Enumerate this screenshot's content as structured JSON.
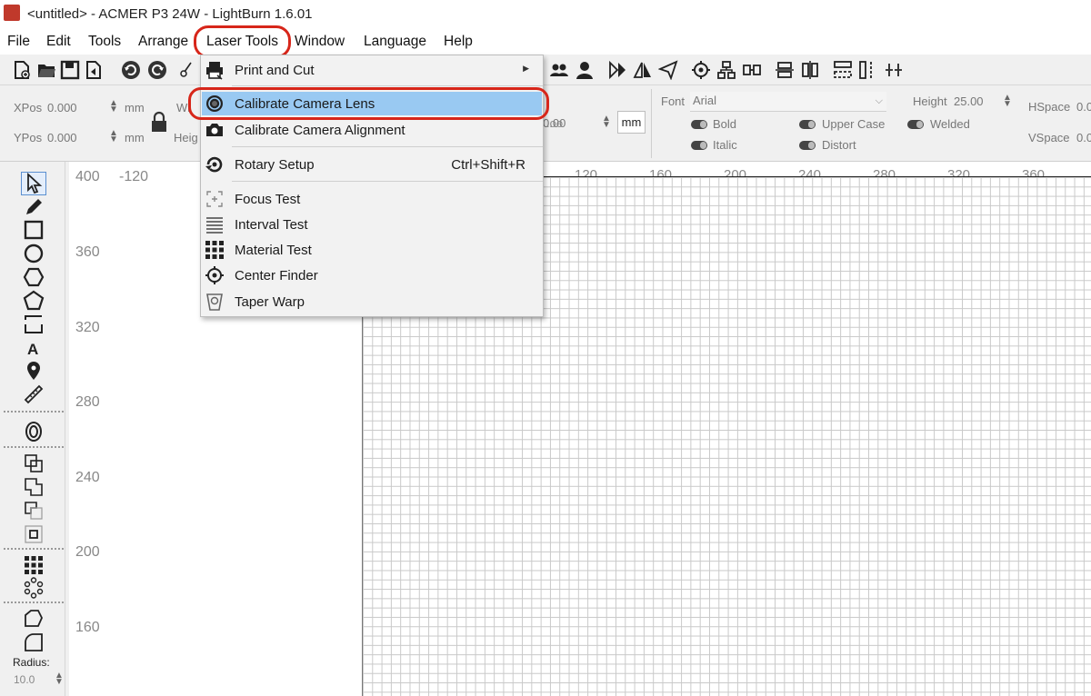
{
  "window": {
    "title": "<untitled> - ACMER P3 24W - LightBurn 1.6.01"
  },
  "menubar": {
    "items": [
      "File",
      "Edit",
      "Tools",
      "Arrange",
      "Laser Tools",
      "Window",
      "Language",
      "Help"
    ]
  },
  "props": {
    "xpos_label": "XPos",
    "xpos_value": "0.000",
    "ypos_label": "YPos",
    "ypos_value": "0.000",
    "unit": "mm",
    "width_label": "Wi",
    "height_label": "Heig",
    "hidden_value": "0.00",
    "unit_box": "mm",
    "font_label": "Font",
    "font_value": "Arial",
    "height_field_label": "Height",
    "height_value": "25.00",
    "hspace_label": "HSpace",
    "hspace_value": "0.0",
    "vspace_label": "VSpace",
    "vspace_value": "0.0",
    "bold": "Bold",
    "italic": "Italic",
    "upper_case": "Upper Case",
    "distort": "Distort",
    "welded": "Welded"
  },
  "laser_tools_menu": [
    {
      "label": "Print and Cut",
      "shortcut": "",
      "submenu": true
    },
    {
      "label": "Calibrate Camera Lens",
      "shortcut": "",
      "highlighted": true
    },
    {
      "label": "Calibrate Camera Alignment",
      "shortcut": ""
    },
    {
      "label": "Rotary Setup",
      "shortcut": "Ctrl+Shift+R"
    },
    {
      "label": "Focus Test",
      "shortcut": ""
    },
    {
      "label": "Interval Test",
      "shortcut": ""
    },
    {
      "label": "Material Test",
      "shortcut": ""
    },
    {
      "label": "Center Finder",
      "shortcut": ""
    },
    {
      "label": "Taper Warp",
      "shortcut": ""
    }
  ],
  "rulers": {
    "left_ticks": [
      "400",
      "360",
      "320",
      "280",
      "240",
      "200",
      "160"
    ],
    "top_start": "-120",
    "top_ticks": [
      "120",
      "160",
      "200",
      "240",
      "280",
      "320",
      "360"
    ],
    "top_decimal": ".oo"
  },
  "left_panel": {
    "radius_label": "Radius:",
    "radius_value": "10.0"
  },
  "colors": {
    "highlight": "#99c9f2",
    "annotation_ring": "#d7261a",
    "grid_line": "#c9c9c9"
  }
}
